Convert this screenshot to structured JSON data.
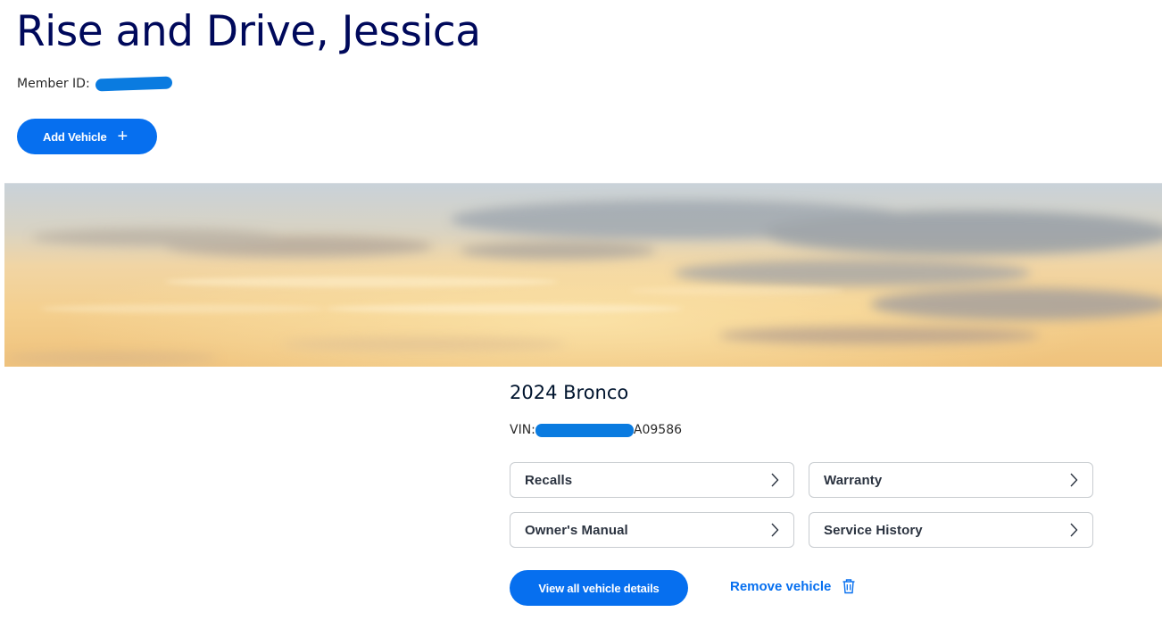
{
  "header": {
    "greeting": "Rise and Drive, Jessica",
    "member_id_label": "Member ID:"
  },
  "actions": {
    "add_vehicle_label": "Add Vehicle",
    "add_vehicle_icon": "plus-icon"
  },
  "vehicle": {
    "name": "2024 Bronco",
    "vin_label": "VIN:",
    "vin_suffix": "A09586",
    "links": [
      {
        "label": "Recalls",
        "icon": "chevron-right-icon"
      },
      {
        "label": "Warranty",
        "icon": "chevron-right-icon"
      },
      {
        "label": "Owner's Manual",
        "icon": "chevron-right-icon"
      },
      {
        "label": "Service History",
        "icon": "chevron-right-icon"
      }
    ],
    "view_details_label": "View all vehicle details",
    "remove_label": "Remove vehicle",
    "remove_icon": "trash-icon"
  },
  "colors": {
    "primary": "#066fef",
    "heading": "#00095b",
    "redaction": "#0a7be0"
  }
}
